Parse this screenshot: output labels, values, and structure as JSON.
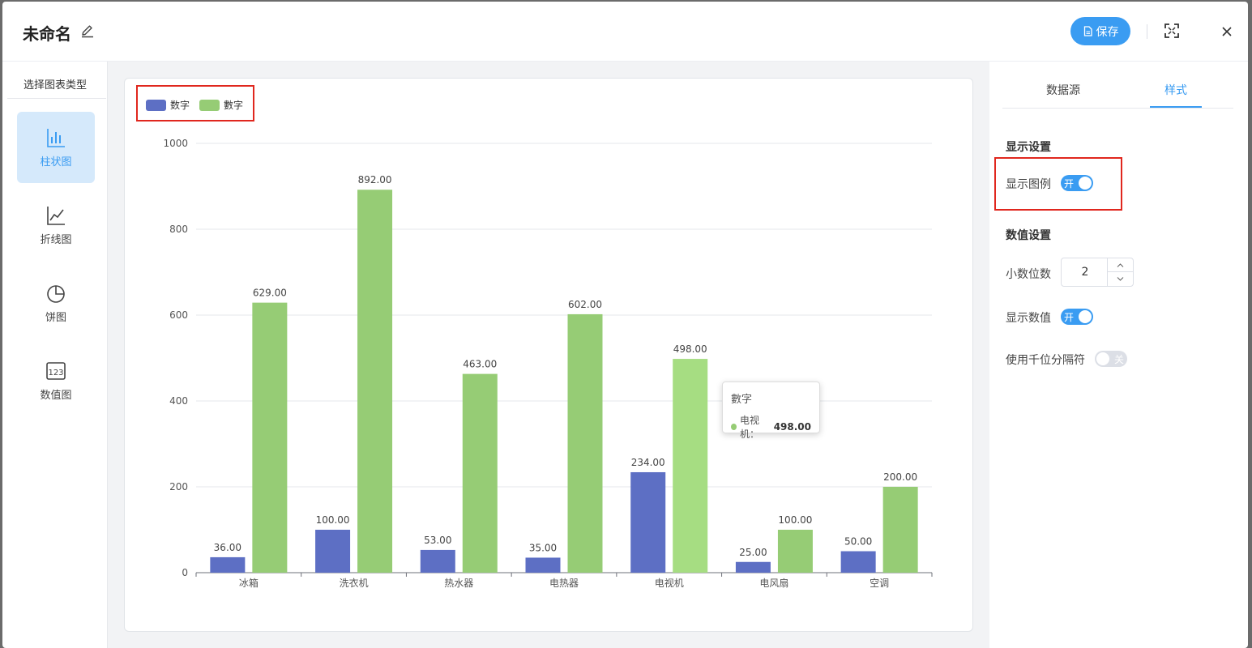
{
  "header": {
    "title": "未命名",
    "save_label": "保存"
  },
  "sidebar": {
    "title": "选择图表类型",
    "items": [
      {
        "label": "柱状图",
        "icon": "bar-chart-icon",
        "active": true
      },
      {
        "label": "折线图",
        "icon": "line-chart-icon",
        "active": false
      },
      {
        "label": "饼图",
        "icon": "pie-chart-icon",
        "active": false
      },
      {
        "label": "数值图",
        "icon": "number-chart-icon",
        "active": false
      }
    ]
  },
  "chart_data": {
    "type": "bar",
    "categories": [
      "冰箱",
      "洗衣机",
      "热水器",
      "电热器",
      "电视机",
      "电风扇",
      "空调"
    ],
    "series": [
      {
        "name": "数字",
        "color": "#5d6fc4",
        "values": [
          36,
          100,
          53,
          35,
          234,
          25,
          50
        ]
      },
      {
        "name": "數字",
        "color": "#96cc75",
        "values": [
          629,
          892,
          463,
          602,
          498,
          100,
          200
        ]
      }
    ],
    "data_labels": [
      [
        "36.00",
        "100.00",
        "53.00",
        "35.00",
        "234.00",
        "25.00",
        "50.00"
      ],
      [
        "629.00",
        "892.00",
        "463.00",
        "602.00",
        "498.00",
        "100.00",
        "200.00"
      ]
    ],
    "yticks": [
      "0",
      "200",
      "400",
      "600",
      "800",
      "1000"
    ],
    "ylim": [
      0,
      1000
    ],
    "grid": true,
    "legend": "top-left",
    "highlight": {
      "series": 1,
      "index": 4,
      "color": "#a6dd82"
    }
  },
  "tooltip": {
    "title": "數字",
    "label": "电视机：",
    "value": "498.00",
    "dot_color": "#96cc75"
  },
  "right_panel": {
    "tabs": [
      "数据源",
      "样式"
    ],
    "active_tab": "样式",
    "display_section": "显示设置",
    "show_legend_label": "显示图例",
    "show_legend_toggle": "开",
    "value_section": "数值设置",
    "decimal_label": "小数位数",
    "decimal_value": "2",
    "show_value_label": "显示数值",
    "show_value_toggle": "开",
    "thousands_label": "使用千位分隔符",
    "thousands_toggle": "关"
  }
}
